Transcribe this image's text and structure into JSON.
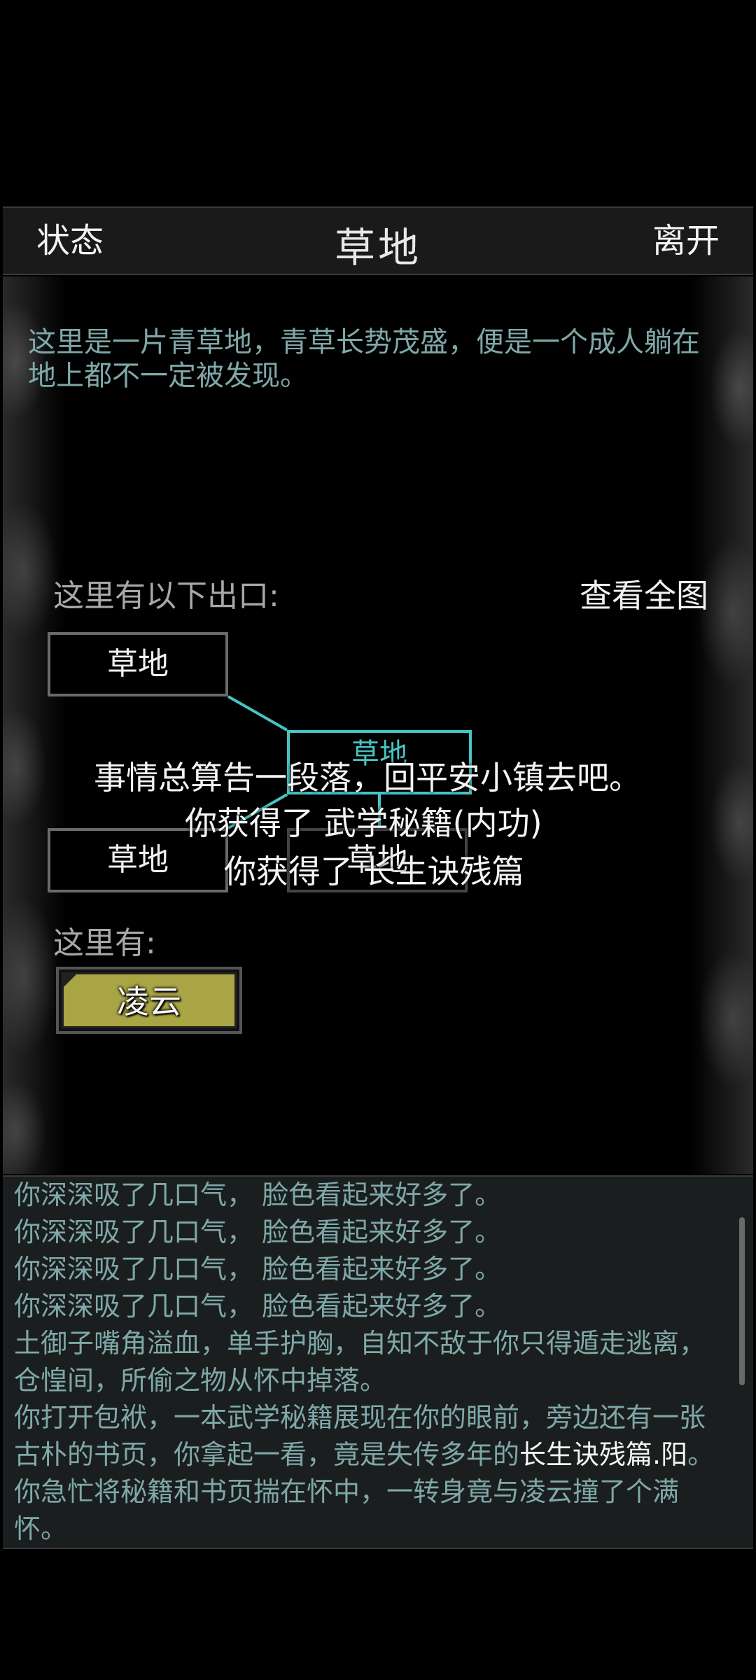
{
  "header": {
    "left_label": "状态",
    "title": "草地",
    "right_label": "离开"
  },
  "scene": {
    "description": "这里是一片青草地，青草长势茂盛，便是一个成人躺在地上都不一定被发现。",
    "exits_label": "这里有以下出口:",
    "view_map_label": "查看全图",
    "exits": [
      "草地",
      "草地"
    ],
    "current_location": "草地",
    "partial_exit": "草地",
    "here_label": "这里有:",
    "npc_name": "凌云"
  },
  "floating_messages": [
    "事情总算告一段落，回平安小镇去吧。",
    "你获得了 武学秘籍(内功)",
    "你获得了 长生诀残篇"
  ],
  "log": {
    "lines": [
      "你深深吸了几口气， 脸色看起来好多了。",
      "你深深吸了几口气， 脸色看起来好多了。",
      "你深深吸了几口气， 脸色看起来好多了。",
      "你深深吸了几口气， 脸色看起来好多了。",
      "土御子嘴角溢血，单手护胸，自知不敌于你只得遁走逃离，仓惶间，所偷之物从怀中掉落。"
    ],
    "last_entry": {
      "before": "你打开包袱，一本武学秘籍展现在你的眼前，旁边还有一张古朴的书页，你拿起一看，竟是失传多年的",
      "highlight": "长生诀残篇.阳",
      "after": "。你急忙将秘籍和书页揣在怀中，一转身竟与凌云撞了个满怀。"
    }
  },
  "colors": {
    "accent_cyan": "#48c4c4",
    "text_teal": "#7fa8a8",
    "npc_button": "#aaa544"
  }
}
